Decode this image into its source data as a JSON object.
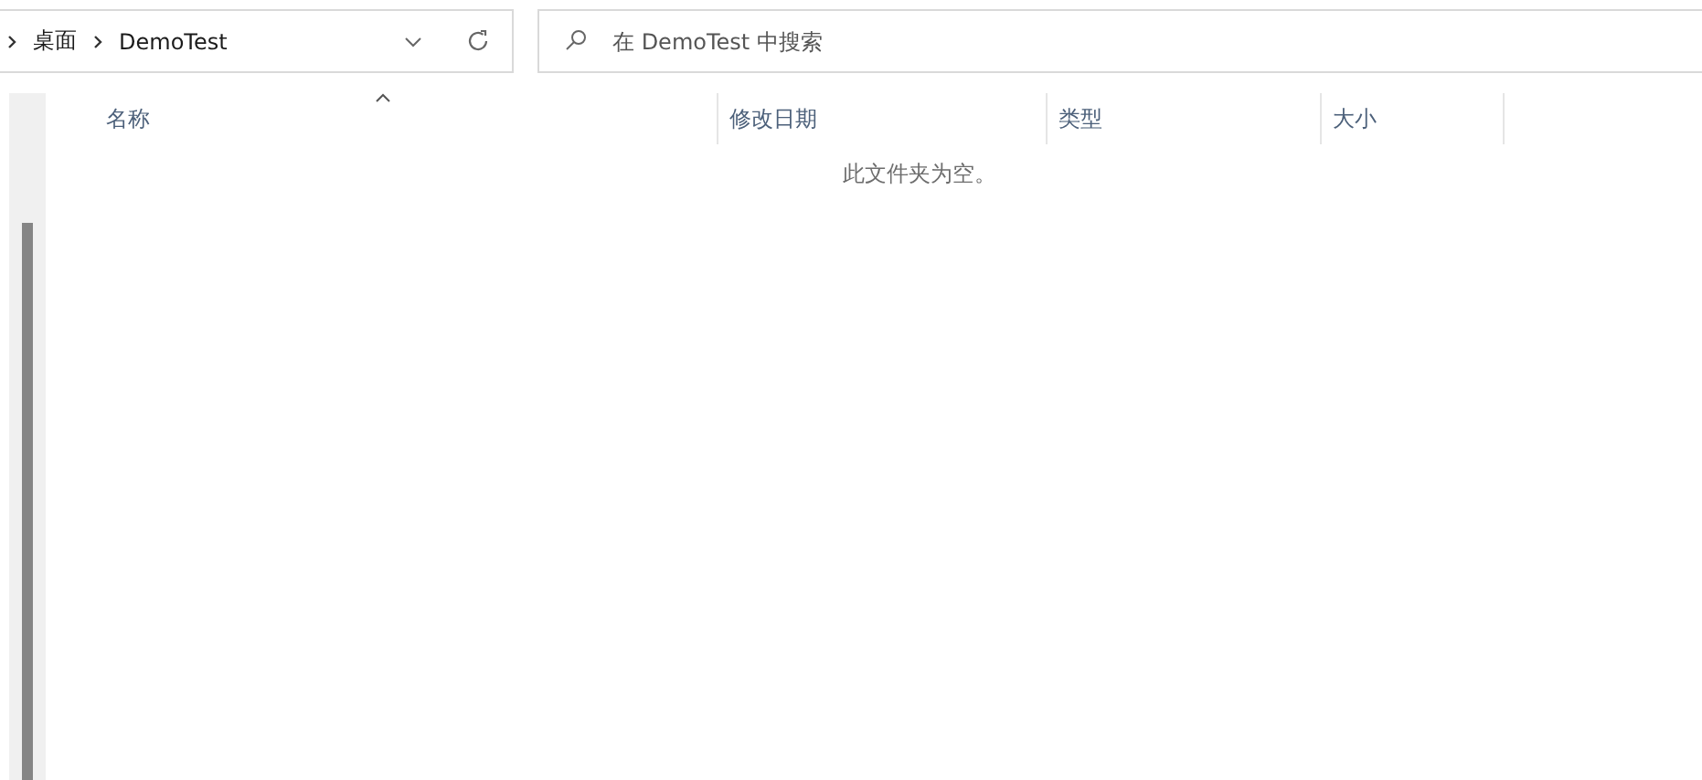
{
  "address_bar": {
    "path": [
      "桌面",
      "DemoTest"
    ]
  },
  "search": {
    "placeholder": "在 DemoTest 中搜索"
  },
  "columns": [
    {
      "label": "名称",
      "sorted": true
    },
    {
      "label": "修改日期",
      "sorted": false
    },
    {
      "label": "类型",
      "sorted": false
    },
    {
      "label": "大小",
      "sorted": false
    }
  ],
  "empty_message": "此文件夹为空。"
}
